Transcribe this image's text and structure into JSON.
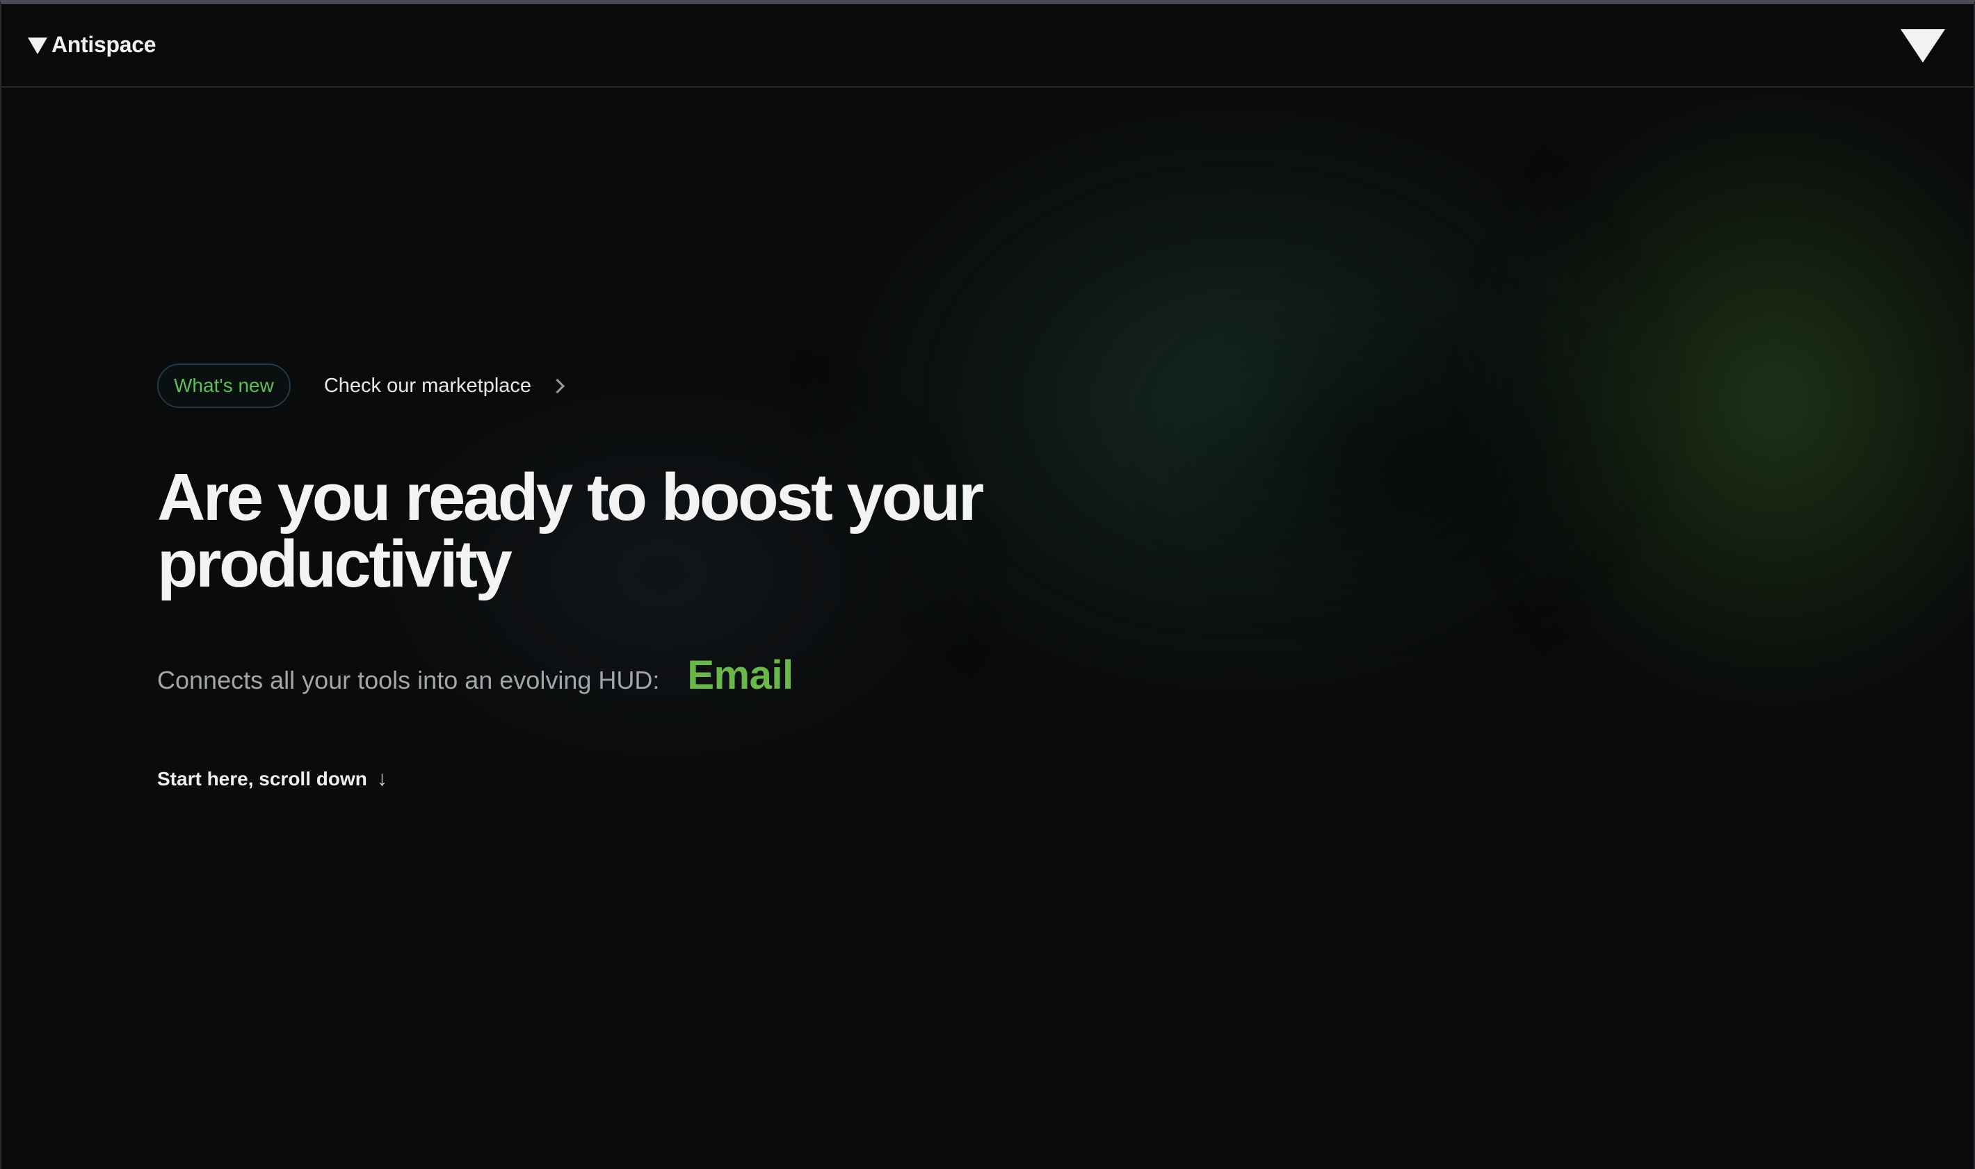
{
  "brand": {
    "name": "Antispace",
    "accent_color": "#6ab84a",
    "background_color": "#0a0b0b"
  },
  "navbar": {
    "logo_icon": "triangle-down-logo-icon",
    "menu_icon": "triangle-down-icon"
  },
  "hero": {
    "badge_label": "What's new",
    "announcement_link": "Check our marketplace",
    "announcement_icon": "chevron-right-icon",
    "headline_line1": "Are you ready to boost your",
    "headline_line2": "productivity",
    "subline_text": "Connects all your tools into an evolving HUD:",
    "subline_rotating_word": "Email",
    "cta_label": "Start here, scroll down",
    "cta_arrow": "↓"
  }
}
